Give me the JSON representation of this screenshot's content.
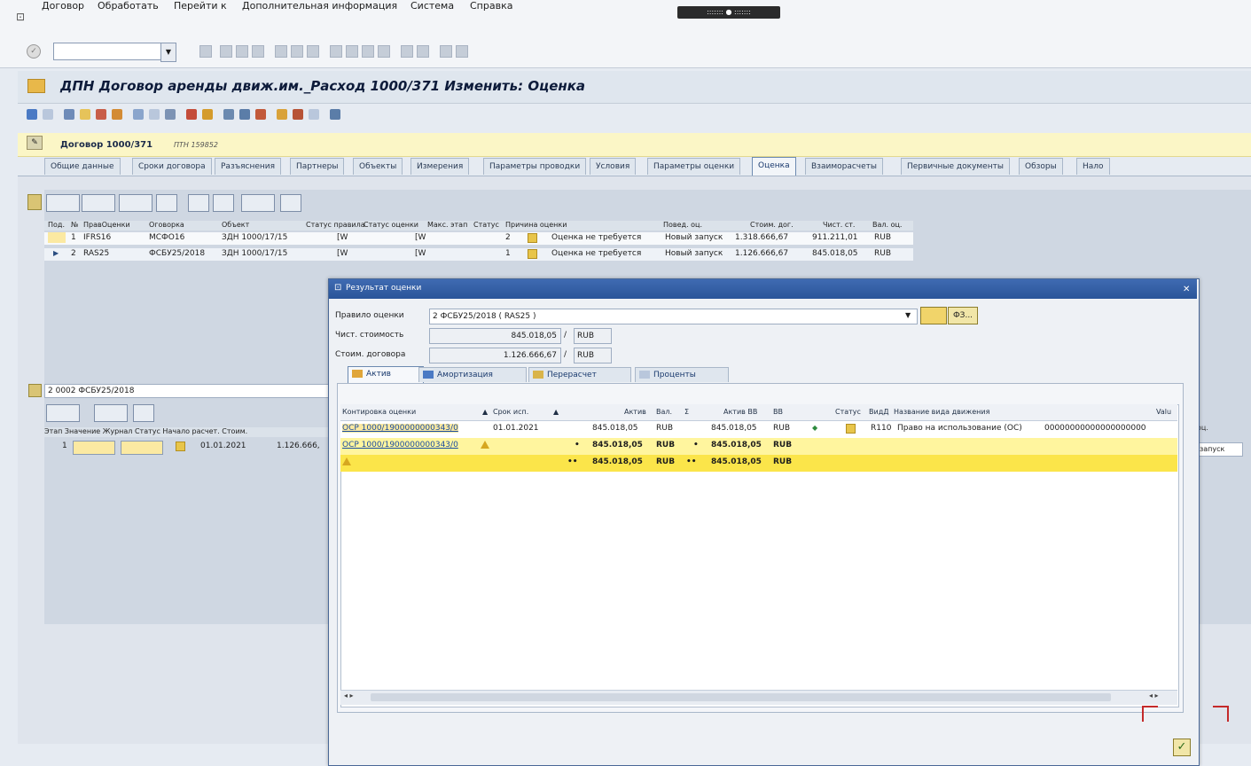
{
  "menu": {
    "items": [
      "Договор",
      "Обработать",
      "Перейти к",
      "Дополнительная информация",
      "Система",
      "Справка"
    ],
    "window_tab": "::::::: ● :::::::"
  },
  "title": "ДПН Договор аренды движ.им._Расход 1000/371 Изменить: Оценка",
  "contract": {
    "label": "Договор 1000/371",
    "sub": "ПТН 159852"
  },
  "tabs": [
    "Общие данные",
    "Сроки договора",
    "Разъяснения",
    "Партнеры",
    "Объекты",
    "Измерения",
    "Параметры проводки",
    "Условия",
    "Параметры оценки",
    "Оценка",
    "Взаиморасчеты",
    "Первичные документы",
    "Обзоры",
    "Нало"
  ],
  "active_tab": "Оценка",
  "grid1": {
    "headers": [
      "Под.",
      "№",
      "ПравОценки",
      "Оговорка",
      "Объект",
      "Статус правила",
      "Статус оценки",
      "Макс. этап",
      "Статус",
      "Причина оценки",
      "Повед. оц.",
      "Стоим. дог.",
      "Чист. ст.",
      "Вал. оц."
    ],
    "rows": [
      {
        "num": "1",
        "rule": "IFRS16",
        "clause": "МСФО16",
        "object": "ЗДН 1000/17/15",
        "rule_status": "[W",
        "eval_status": "[W",
        "stage": "2",
        "reason": "Оценка не требуется",
        "behavior": "Новый запуск",
        "cost": "1.318.666,67",
        "net": "911.211,01",
        "cur": "RUB"
      },
      {
        "num": "2",
        "rule": "RAS25",
        "clause": "ФСБУ25/2018",
        "object": "ЗДН 1000/17/15",
        "rule_status": "[W",
        "eval_status": "[W",
        "stage": "1",
        "reason": "Оценка не требуется",
        "behavior": "Новый запуск",
        "cost": "1.126.666,67",
        "net": "845.018,05",
        "cur": "RUB"
      }
    ]
  },
  "section2": {
    "field": "2 0002 ФСБУ25/2018",
    "headers": "Этап Значение Журнал Статус Начало расчет. Стоим.",
    "row": {
      "stage": "1",
      "date": "01.01.2021",
      "cost": "1.126.666,"
    },
    "right_head": "оц.",
    "right_val": "запуск"
  },
  "dialog": {
    "title": "Результат оценки",
    "rule_label": "Правило оценки",
    "rule_value": "2 ФСБУ25/2018 ( RAS25 )",
    "btn_fz": "ФЗ...",
    "net_label": "Чист. стоимость",
    "net_value": "845.018,05",
    "net_cur": "RUB",
    "contract_label": "Стоим. договора",
    "contract_value": "1.126.666,67",
    "contract_cur": "RUB",
    "tabs": [
      "Актив",
      "Амортизация",
      "Перерасчет",
      "Проценты"
    ],
    "active_tab": "Актив",
    "table": {
      "headers": [
        "Контировка оценки",
        "Срок исп.",
        "Актив",
        "Вал.",
        "Актив ВВ",
        "ВВ",
        "Статус",
        "ВидД",
        "Название вида движения",
        "Valu"
      ],
      "rows": [
        {
          "account": "ОСР 1000/1900000000343/0",
          "date": "01.01.2021",
          "asset": "845.018,05",
          "cur": "RUB",
          "asset_bb": "845.018,05",
          "cur_bb": "RUB",
          "mark": "◆",
          "kind": "R110",
          "name": "Право на использование (ОС)",
          "value": "00000000000000000000"
        },
        {
          "account": "ОСР 1000/1900000000343/0",
          "date": "",
          "asset": "845.018,05",
          "cur": "RUB",
          "asset_bb": "845.018,05",
          "cur_bb": "RUB",
          "prefix": "•",
          "prefix_bb": "•"
        },
        {
          "account": "",
          "date": "",
          "asset": "845.018,05",
          "cur": "RUB",
          "asset_bb": "845.018,05",
          "cur_bb": "RUB",
          "prefix": "••",
          "prefix_bb": "••"
        }
      ]
    }
  },
  "colors": {
    "header_yellow": "#fbf6c6",
    "row_yellow": "#fff59e",
    "total_yellow": "#fbe54a",
    "dialog_title": "#2a5599"
  }
}
